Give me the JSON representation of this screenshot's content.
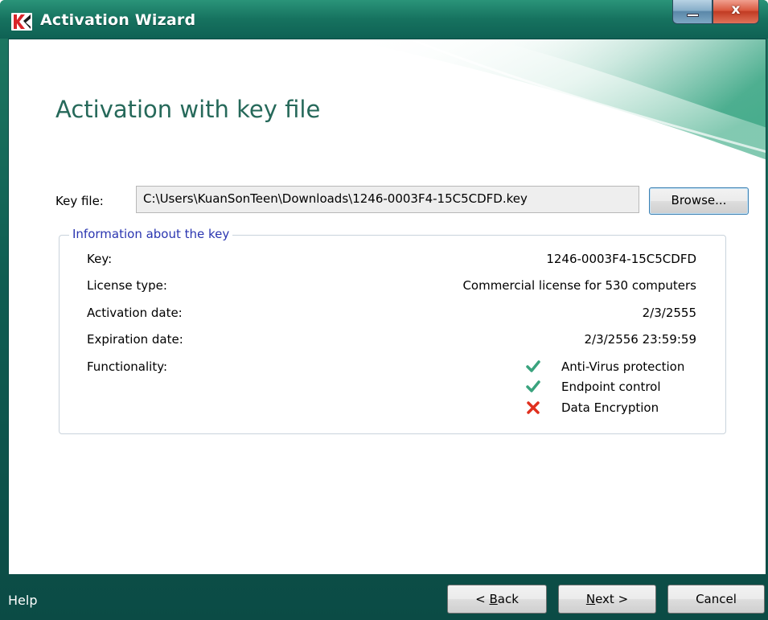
{
  "window": {
    "title": "Activation Wizard",
    "min_icon": "minimize-icon",
    "close_glyph": "x",
    "close_icon": "close-icon"
  },
  "page": {
    "heading": "Activation with key file"
  },
  "key_file": {
    "label": "Key file:",
    "value": "C:\\Users\\KuanSonTeen\\Downloads\\1246-0003F4-15C5CDFD.key",
    "browse_label": "Browse..."
  },
  "info": {
    "title": "Information about the key",
    "rows": [
      {
        "label": "Key:",
        "value": "1246-0003F4-15C5CDFD"
      },
      {
        "label": "License type:",
        "value": "Commercial license for 530 computers"
      },
      {
        "label": "Activation date:",
        "value": "2/3/2555"
      },
      {
        "label": "Expiration date:",
        "value": "2/3/2556 23:59:59"
      },
      {
        "label": "Functionality:",
        "value": ""
      }
    ],
    "features": [
      {
        "name": "Anti-Virus protection",
        "status": "enabled",
        "icon": "check-icon"
      },
      {
        "name": "Endpoint control",
        "status": "enabled",
        "icon": "check-icon"
      },
      {
        "name": "Data Encryption",
        "status": "disabled",
        "icon": "cross-icon"
      }
    ]
  },
  "footer": {
    "help": "Help",
    "back_prefix": "< ",
    "back_key": "B",
    "back_rest": "ack",
    "next_key": "N",
    "next_rest": "ext >",
    "cancel": "Cancel"
  },
  "colors": {
    "titlebar": "#16725f",
    "heading": "#26695a",
    "group_title": "#2a35b0",
    "check": "#3aa37e",
    "cross": "#e0301e"
  }
}
